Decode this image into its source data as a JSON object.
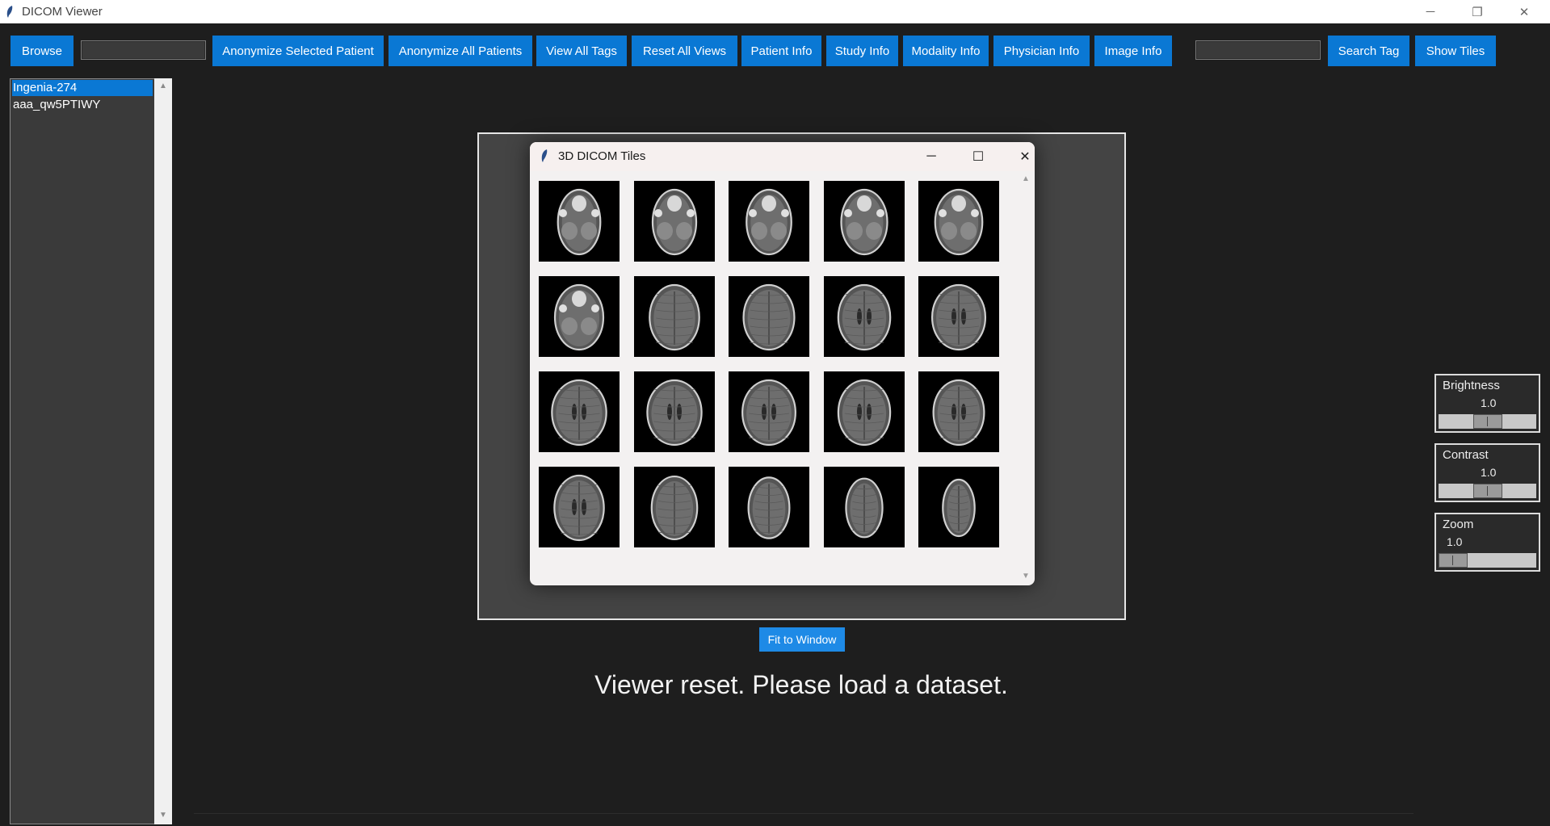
{
  "window": {
    "title": "DICOM Viewer",
    "minimize": "─",
    "maximize": "❐",
    "close": "✕"
  },
  "toolbar": {
    "browse": "Browse",
    "anonymize_selected": "Anonymize Selected Patient",
    "anonymize_all": "Anonymize All Patients",
    "view_all_tags": "View All Tags",
    "reset_all_views": "Reset All Views",
    "patient_info": "Patient Info",
    "study_info": "Study Info",
    "modality_info": "Modality Info",
    "physician_info": "Physician Info",
    "image_info": "Image Info",
    "search_tag": "Search Tag",
    "show_tiles": "Show Tiles",
    "path_input_value": "",
    "search_input_value": ""
  },
  "patients": [
    {
      "label": "Ingenia-274",
      "selected": true
    },
    {
      "label": "aaa_qw5PTIWY",
      "selected": false
    }
  ],
  "scroll": {
    "up": "▲",
    "down": "▼"
  },
  "dialog": {
    "title": "3D DICOM Tiles",
    "minimize": "─",
    "maximize": "☐",
    "close": "✕",
    "tile_count": 20,
    "columns": 5
  },
  "viewer": {
    "fit_button": "Fit to Window",
    "status": "Viewer reset. Please load a dataset."
  },
  "sliders": {
    "brightness": {
      "label": "Brightness",
      "value": "1.0",
      "level": 0.5
    },
    "contrast": {
      "label": "Contrast",
      "value": "1.0",
      "level": 0.5
    },
    "zoom": {
      "label": "Zoom",
      "value": "1.0",
      "level": 0.0
    }
  },
  "colors": {
    "accent": "#0a78d4",
    "background": "#1e1e1e",
    "panel": "#3a3a3a"
  }
}
